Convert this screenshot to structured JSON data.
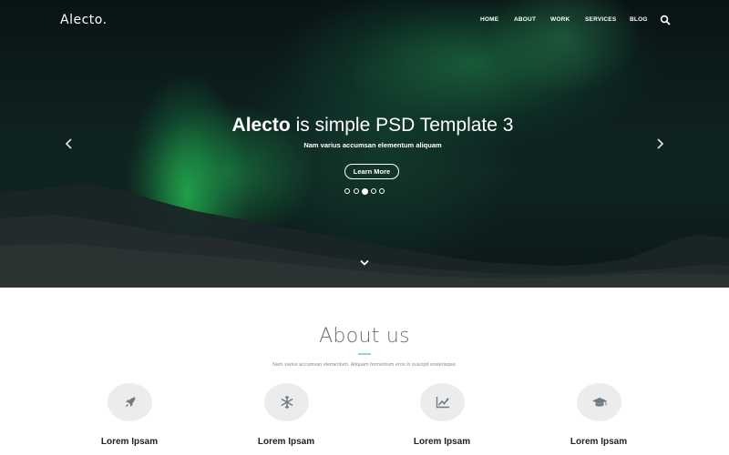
{
  "header": {
    "logo": "Alecto.",
    "nav": [
      "HOME",
      "ABOUT",
      "WORK",
      "SERVICES",
      "BLOG"
    ],
    "search_icon": "search-icon"
  },
  "hero": {
    "title_brand": "Alecto",
    "title_rest": " is simple PSD Template 3",
    "subtitle": "Nam varius accumsan elementum aliquam",
    "button_label": "Learn More",
    "slides_total": 5,
    "active_slide": 3,
    "prev_icon": "chevron-left-icon",
    "next_icon": "chevron-right-icon",
    "scroll_icon": "chevron-down-icon"
  },
  "about": {
    "title": "About us",
    "description": "Nam varius accumsan elementum. Aliquam fermentum eros in suscipit scelerisque.",
    "accent_color": "#8fd7c4",
    "features": [
      {
        "label": "Lorem Ipsam",
        "icon": "rocket-icon"
      },
      {
        "label": "Lorem Ipsam",
        "icon": "snowflake-icon"
      },
      {
        "label": "Lorem Ipsam",
        "icon": "chart-line-icon"
      },
      {
        "label": "Lorem Ipsam",
        "icon": "graduation-cap-icon"
      }
    ]
  }
}
